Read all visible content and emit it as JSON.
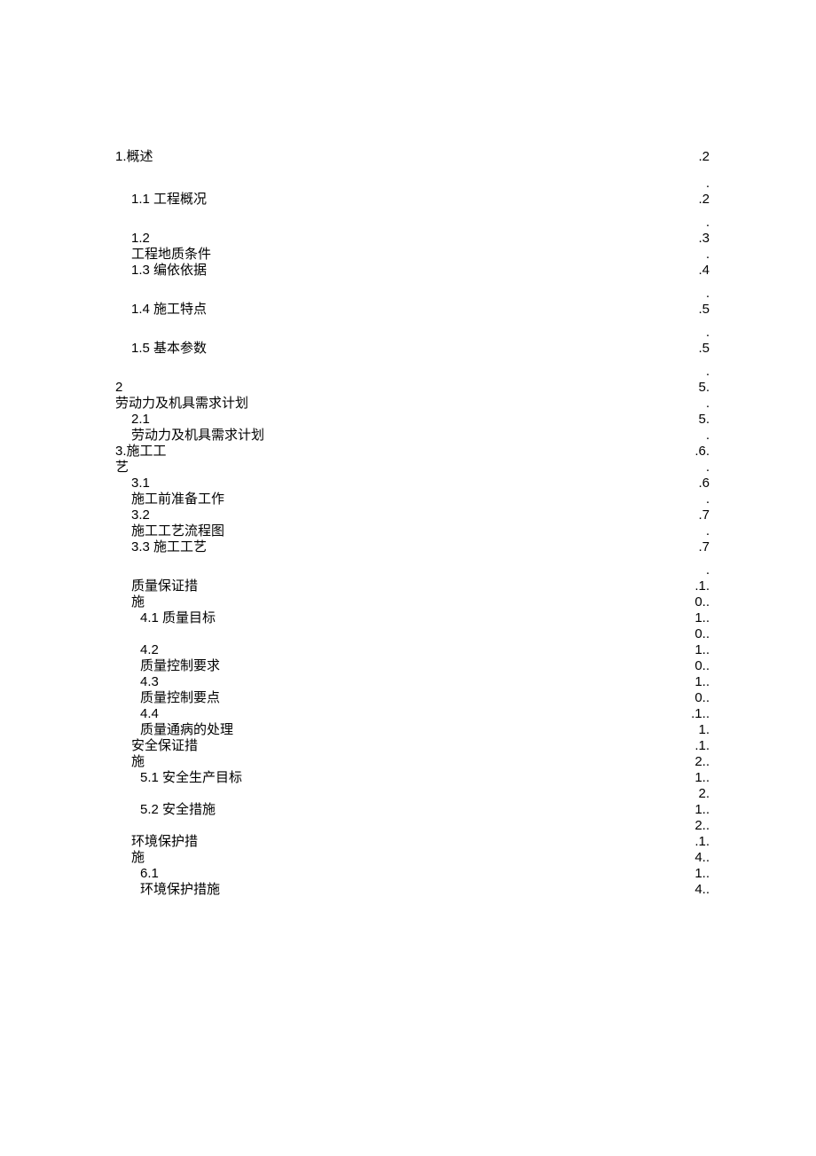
{
  "toc": {
    "r1_left": "1.概述",
    "r1_right": ".2",
    "r1b_right": ".",
    "r2_left": "1.1 工程概况",
    "r2_right": ".2",
    "r2b_right": ".",
    "r3a_left": "1.2",
    "r3a_right": ".3",
    "r3b_left": "工程地质条件",
    "r3b_right": ".",
    "r4_left": "1.3 编依依据",
    "r4_right": ".4",
    "r4b_right": ".",
    "r5_left": "1.4 施工特点",
    "r5_right": ".5",
    "r5b_right": ".",
    "r6_left": "1.5 基本参数",
    "r6_right": ".5",
    "r6b_right": ".",
    "r7a_left": "2",
    "r7a_right": "5.",
    "r7b_left": "劳动力及机具需求计划",
    "r7b_right": ".",
    "r8a_left": "2.1",
    "r8a_right": "5.",
    "r8b_left": "劳动力及机具需求计划",
    "r8b_right": ".",
    "r9a_left": "3.施工工",
    "r9a_right": ".6.",
    "r9b_left": "艺",
    "r9b_right": ".",
    "r10a_left": "3.1",
    "r10a_right": ".6",
    "r10b_left": "施工前准备工作",
    "r10b_right": ".",
    "r11a_left": "3.2",
    "r11a_right": ".7",
    "r11b_left": "施工工艺流程图",
    "r11b_right": ".",
    "r12_left": "3.3 施工工艺",
    "r12_right": ".7",
    "r12b_right": ".",
    "r13a_left": "质量保证措",
    "r13a_right": ".1.",
    "r13b_left": "施",
    "r13b_right": "0..",
    "r14a_left": "4.1 质量目标",
    "r14a_right": "1..",
    "r14b_right": "0..",
    "r15a_left": "4.2",
    "r15a_right": "1..",
    "r15b_left": "质量控制要求",
    "r15b_right": "0..",
    "r16a_left": "4.3",
    "r16a_right": "1..",
    "r16b_left": "质量控制要点",
    "r16b_right": "0..",
    "r17a_left": "4.4",
    "r17a_right": ".1..",
    "r17b_left": "质量通病的处理",
    "r17b_right": "1.",
    "r18a_left": "安全保证措",
    "r18a_right": ".1.",
    "r18b_left": "施",
    "r18b_right": "2..",
    "r19a_left": "5.1 安全生产目标",
    "r19a_right": "1..",
    "r19b_right": "2.",
    "r20a_left": "5.2 安全措施",
    "r20a_right": "1..",
    "r20b_right": "2..",
    "r21a_left": "环境保护措",
    "r21a_right": ".1.",
    "r21b_left": "施",
    "r21b_right": "4..",
    "r22a_left": "6.1",
    "r22a_right": "1..",
    "r22b_left": "环境保护措施",
    "r22b_right": "4.."
  }
}
